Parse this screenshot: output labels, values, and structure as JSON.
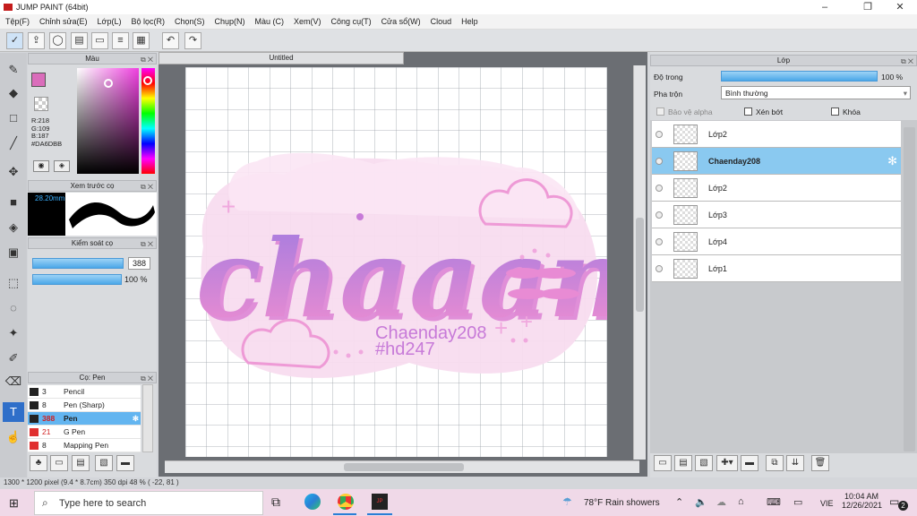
{
  "window": {
    "title": "JUMP PAINT (64bit)",
    "controls": [
      "–",
      "❐",
      "✕"
    ]
  },
  "menu": [
    "Tệp(F)",
    "Chỉnh sửa(E)",
    "Lớp(L)",
    "Bộ lọc(R)",
    "Chọn(S)",
    "Chụp(N)",
    "Màu (C)",
    "Xem(V)",
    "Công cụ(T)",
    "Cửa sổ(W)",
    "Cloud",
    "Help"
  ],
  "toolbar": {
    "undo": "↶",
    "redo": "↷"
  },
  "color_panel": {
    "title": "Màu",
    "r": "R:218",
    "g": "G:109",
    "b": "B:187",
    "hex": "#DA6DBB",
    "fg": "#da6dbb",
    "bg": "#f5a0d6"
  },
  "brush_preview": {
    "title": "Xem trước cọ",
    "size": "28.20mm"
  },
  "brush_control": {
    "title": "Kiểm soát cọ",
    "size": "388",
    "opacity": "100 %"
  },
  "brush_list": {
    "title": "Cọ: Pen",
    "items": [
      {
        "size": "3",
        "name": "Pencil",
        "color": "#222222"
      },
      {
        "size": "8",
        "name": "Pen (Sharp)",
        "color": "#222222"
      },
      {
        "size": "388",
        "name": "Pen",
        "color": "#222222",
        "selected": true
      },
      {
        "size": "21",
        "name": "G Pen",
        "color": "#e03030"
      },
      {
        "size": "8",
        "name": "Mapping Pen",
        "color": "#e03030"
      }
    ]
  },
  "document": {
    "tab": "Untitled"
  },
  "artwork": {
    "word": "chaaan",
    "line1": "Chaenday208",
    "line2": "#hd247"
  },
  "layer_panel": {
    "title": "Lớp",
    "opacity_label": "Độ trong",
    "opacity_value": "100 %",
    "opacity_fraction": 1.0,
    "blend_label": "Pha trộn",
    "blend_value": "Bình thường",
    "protect_alpha": "Bảo vệ alpha",
    "clipping": "Xén bớt",
    "lock": "Khóa",
    "layers": [
      {
        "name": "Lớp2",
        "selected": false
      },
      {
        "name": "Chaenday208",
        "selected": true
      },
      {
        "name": "Lớp2",
        "selected": false
      },
      {
        "name": "Lớp3",
        "selected": false
      },
      {
        "name": "Lớp4",
        "selected": false
      },
      {
        "name": "Lớp1",
        "selected": false
      }
    ]
  },
  "status": {
    "text": "1300 * 1200 pixel  (9.4 * 8.7cm)  350 dpi  48 %  ( -22, 81 )"
  },
  "taskbar": {
    "search_placeholder": "Type here to search",
    "weather": "78°F  Rain showers",
    "lang": "VIE",
    "time": "10:04 AM",
    "date": "12/26/2021",
    "notifications": "2"
  }
}
